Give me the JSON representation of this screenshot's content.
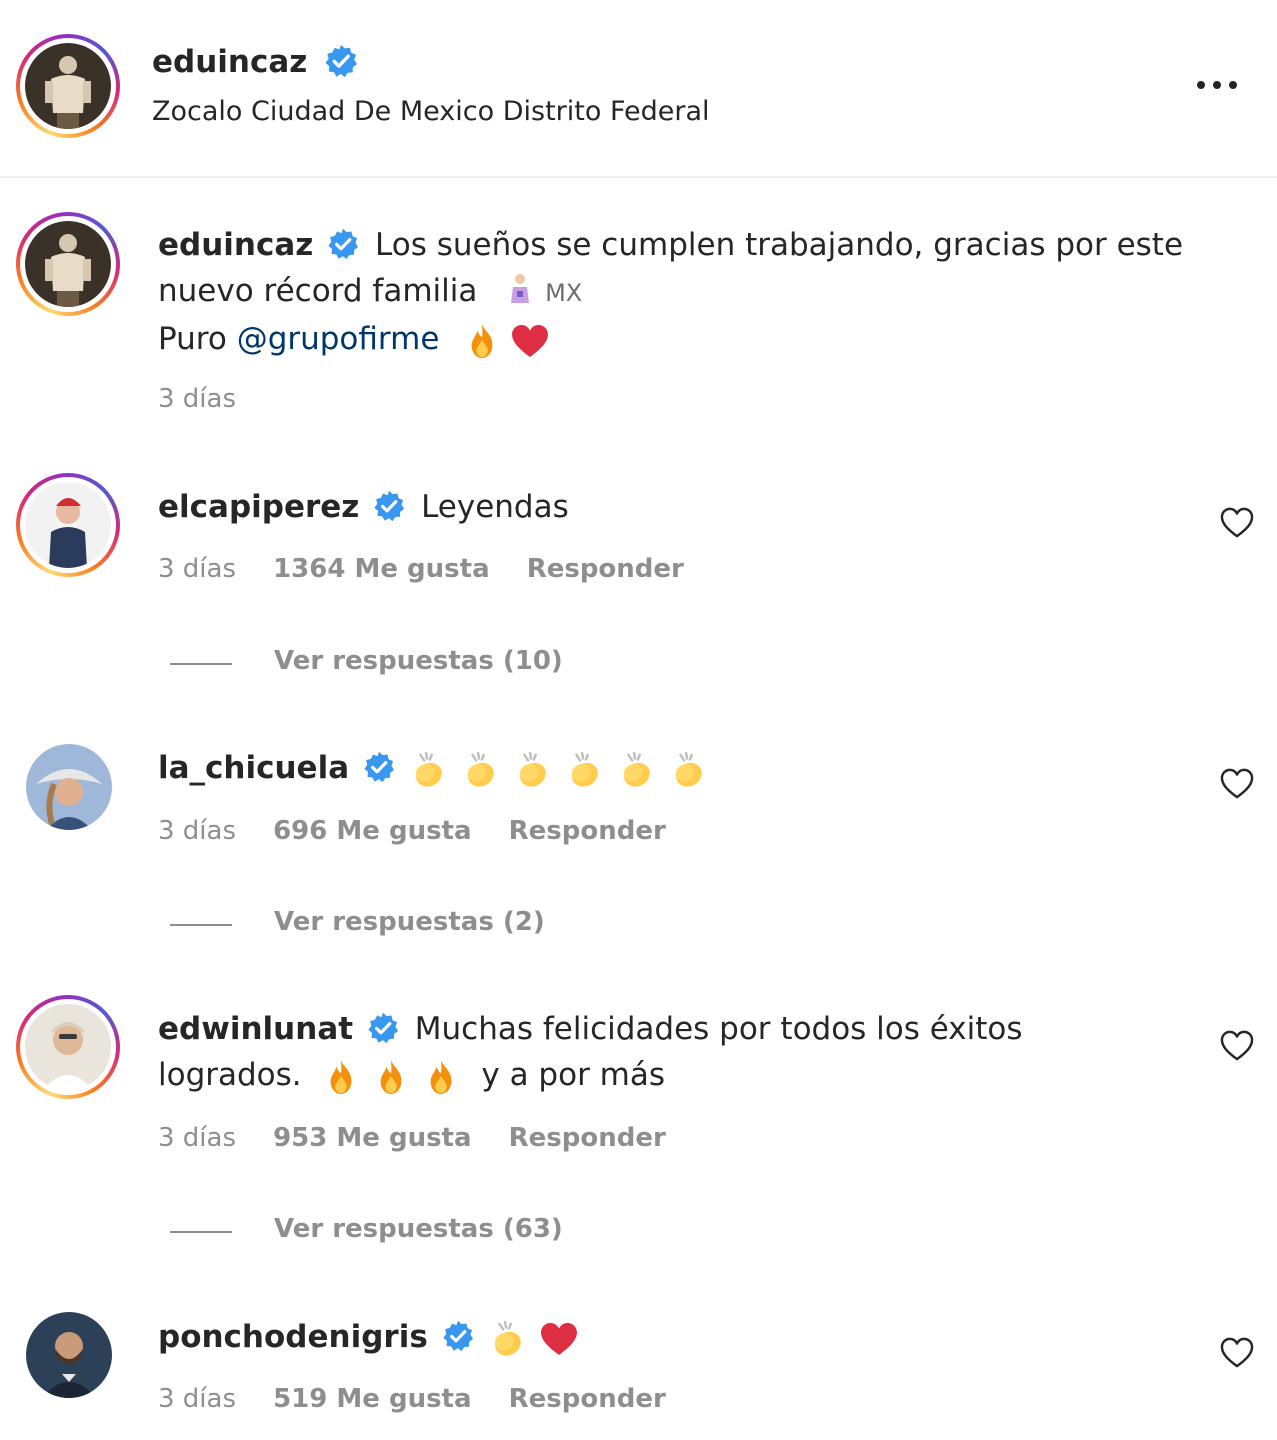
{
  "header": {
    "username": "eduincaz",
    "location": "Zocalo Ciudad De Mexico Distrito Federal",
    "more_icon": "more-options-icon"
  },
  "caption": {
    "username": "eduincaz",
    "line1": "Los sueños se cumplen trabajando, gracias por este",
    "line2": "nuevo récord familia",
    "flag_text": "MX",
    "line3_prefix": "Puro",
    "mention": "@grupofirme",
    "time": "3 días"
  },
  "comments": [
    {
      "username": "elcapiperez",
      "text": "Leyendas",
      "time": "3 días",
      "likes": "1364 Me gusta",
      "reply": "Responder",
      "view_replies": "Ver respuestas (10)"
    },
    {
      "username": "la_chicuela",
      "text": "",
      "emojis": [
        "clap",
        "clap",
        "clap",
        "clap",
        "clap",
        "clap"
      ],
      "time": "3 días",
      "likes": "696 Me gusta",
      "reply": "Responder",
      "view_replies": "Ver respuestas (2)"
    },
    {
      "username": "edwinlunat",
      "text": "Muchas felicidades por todos los éxitos",
      "text_line2_prefix": "logrados.",
      "text_line2_suffix": "y a por más",
      "time": "3 días",
      "likes": "953 Me gusta",
      "reply": "Responder",
      "view_replies": "Ver respuestas (63)"
    },
    {
      "username": "ponchodenigris",
      "text": "",
      "emojis": [
        "clap",
        "heart"
      ],
      "time": "3 días",
      "likes": "519 Me gusta",
      "reply": "Responder"
    }
  ],
  "colors": {
    "verified": "#3897f0",
    "muted": "#8e8e8e",
    "divider": "#efefef",
    "mention": "#00376b"
  }
}
